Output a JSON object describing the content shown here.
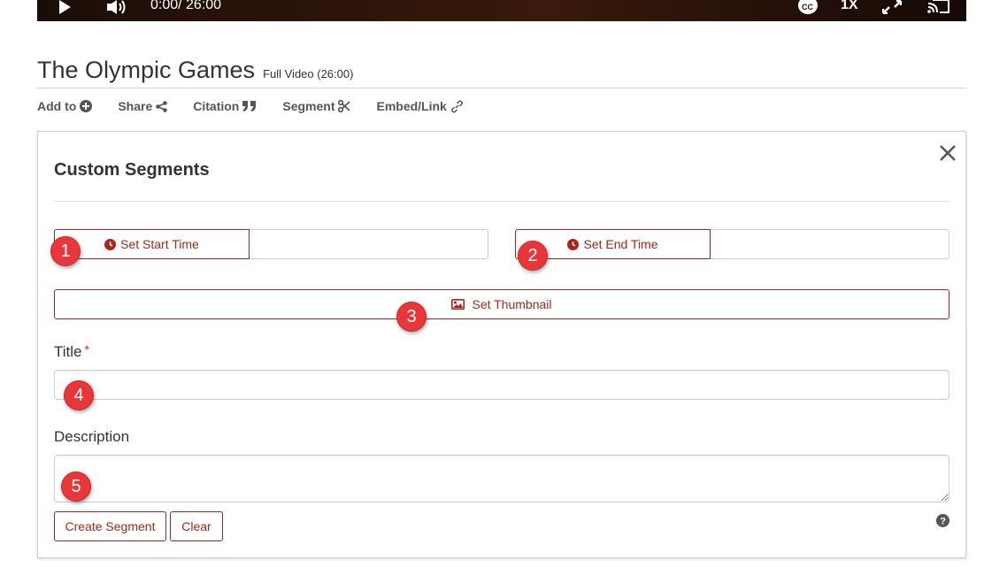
{
  "player": {
    "current_time": "0:00",
    "duration": "/ 26:00",
    "speed": "1X"
  },
  "video": {
    "title": "The Olympic Games",
    "subtitle": "Full Video (26:00)"
  },
  "toolbar": {
    "add_to": "Add to",
    "share": "Share",
    "citation": "Citation",
    "segment": "Segment",
    "embed_link": "Embed/Link"
  },
  "panel": {
    "title": "Custom Segments",
    "set_start_time": "Set Start Time",
    "start_time_value": "",
    "set_end_time": "Set End Time",
    "end_time_value": "",
    "set_thumbnail": "Set Thumbnail",
    "title_label": "Title",
    "required_mark": "*",
    "title_value": "",
    "description_label": "Description",
    "description_value": "",
    "create_button": "Create Segment",
    "clear_button": "Clear"
  },
  "callouts": [
    "1",
    "2",
    "3",
    "4",
    "5"
  ],
  "colors": {
    "accent": "#a8261b",
    "callout": "#e8363a",
    "text": "#333333"
  },
  "icons": {
    "play": "play-icon",
    "volume": "volume-icon",
    "cc": "closed-captions-icon",
    "fullscreen": "fullscreen-icon",
    "cast": "cast-icon",
    "add": "plus-circle-icon",
    "share": "share-icon",
    "citation": "quote-icon",
    "segment": "scissors-icon",
    "embed": "link-icon",
    "close": "close-icon",
    "clock": "clock-icon",
    "image": "image-icon",
    "help": "question-circle-icon"
  }
}
